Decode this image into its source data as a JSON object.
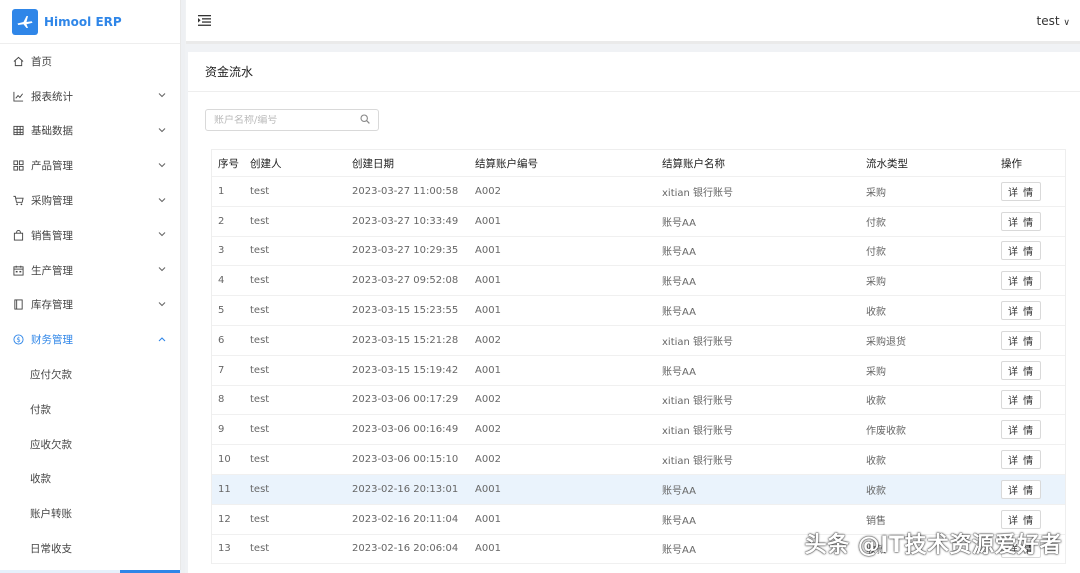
{
  "brand": {
    "name": "Himool ERP"
  },
  "sidebar": {
    "items": [
      {
        "label": "首页",
        "icon": "home-icon",
        "expandable": false
      },
      {
        "label": "报表统计",
        "icon": "chart-line-icon",
        "expandable": true
      },
      {
        "label": "基础数据",
        "icon": "table-icon",
        "expandable": true
      },
      {
        "label": "产品管理",
        "icon": "appstore-icon",
        "expandable": true
      },
      {
        "label": "采购管理",
        "icon": "cart-icon",
        "expandable": true
      },
      {
        "label": "销售管理",
        "icon": "shopping-bag-icon",
        "expandable": true
      },
      {
        "label": "生产管理",
        "icon": "calendar-icon",
        "expandable": true
      },
      {
        "label": "库存管理",
        "icon": "book-icon",
        "expandable": true
      },
      {
        "label": "财务管理",
        "icon": "dollar-icon",
        "expandable": true,
        "active": true
      }
    ],
    "subitems": [
      "应付欠款",
      "付款",
      "应收欠款",
      "收款",
      "账户转账",
      "日常收支"
    ]
  },
  "header": {
    "user": "test"
  },
  "page": {
    "title": "资金流水",
    "search_placeholder": "账户名称/编号"
  },
  "table": {
    "columns": [
      "序号",
      "创建人",
      "创建日期",
      "结算账户编号",
      "结算账户名称",
      "流水类型",
      "操作"
    ],
    "action_label": "详 情",
    "rows": [
      {
        "no": "1",
        "creator": "test",
        "date": "2023-03-27 11:00:58",
        "acct_no": "A002",
        "acct_name": "xitian 银行账号",
        "type": "采购"
      },
      {
        "no": "2",
        "creator": "test",
        "date": "2023-03-27 10:33:49",
        "acct_no": "A001",
        "acct_name": "账号AA",
        "type": "付款"
      },
      {
        "no": "3",
        "creator": "test",
        "date": "2023-03-27 10:29:35",
        "acct_no": "A001",
        "acct_name": "账号AA",
        "type": "付款"
      },
      {
        "no": "4",
        "creator": "test",
        "date": "2023-03-27 09:52:08",
        "acct_no": "A001",
        "acct_name": "账号AA",
        "type": "采购"
      },
      {
        "no": "5",
        "creator": "test",
        "date": "2023-03-15 15:23:55",
        "acct_no": "A001",
        "acct_name": "账号AA",
        "type": "收款"
      },
      {
        "no": "6",
        "creator": "test",
        "date": "2023-03-15 15:21:28",
        "acct_no": "A002",
        "acct_name": "xitian 银行账号",
        "type": "采购退货"
      },
      {
        "no": "7",
        "creator": "test",
        "date": "2023-03-15 15:19:42",
        "acct_no": "A001",
        "acct_name": "账号AA",
        "type": "采购"
      },
      {
        "no": "8",
        "creator": "test",
        "date": "2023-03-06 00:17:29",
        "acct_no": "A002",
        "acct_name": "xitian 银行账号",
        "type": "收款"
      },
      {
        "no": "9",
        "creator": "test",
        "date": "2023-03-06 00:16:49",
        "acct_no": "A002",
        "acct_name": "xitian 银行账号",
        "type": "作废收款"
      },
      {
        "no": "10",
        "creator": "test",
        "date": "2023-03-06 00:15:10",
        "acct_no": "A002",
        "acct_name": "xitian 银行账号",
        "type": "收款"
      },
      {
        "no": "11",
        "creator": "test",
        "date": "2023-02-16 20:13:01",
        "acct_no": "A001",
        "acct_name": "账号AA",
        "type": "收款"
      },
      {
        "no": "12",
        "creator": "test",
        "date": "2023-02-16 20:11:04",
        "acct_no": "A001",
        "acct_name": "账号AA",
        "type": "销售"
      },
      {
        "no": "13",
        "creator": "test",
        "date": "2023-02-16 20:06:04",
        "acct_no": "A001",
        "acct_name": "账号AA",
        "type": "收款"
      }
    ],
    "highlighted_row": 11
  },
  "watermark": "头条 @IT技术资源爱好者",
  "colors": {
    "accent": "#2f86e8",
    "row_highlight": "#eaf3fc"
  }
}
